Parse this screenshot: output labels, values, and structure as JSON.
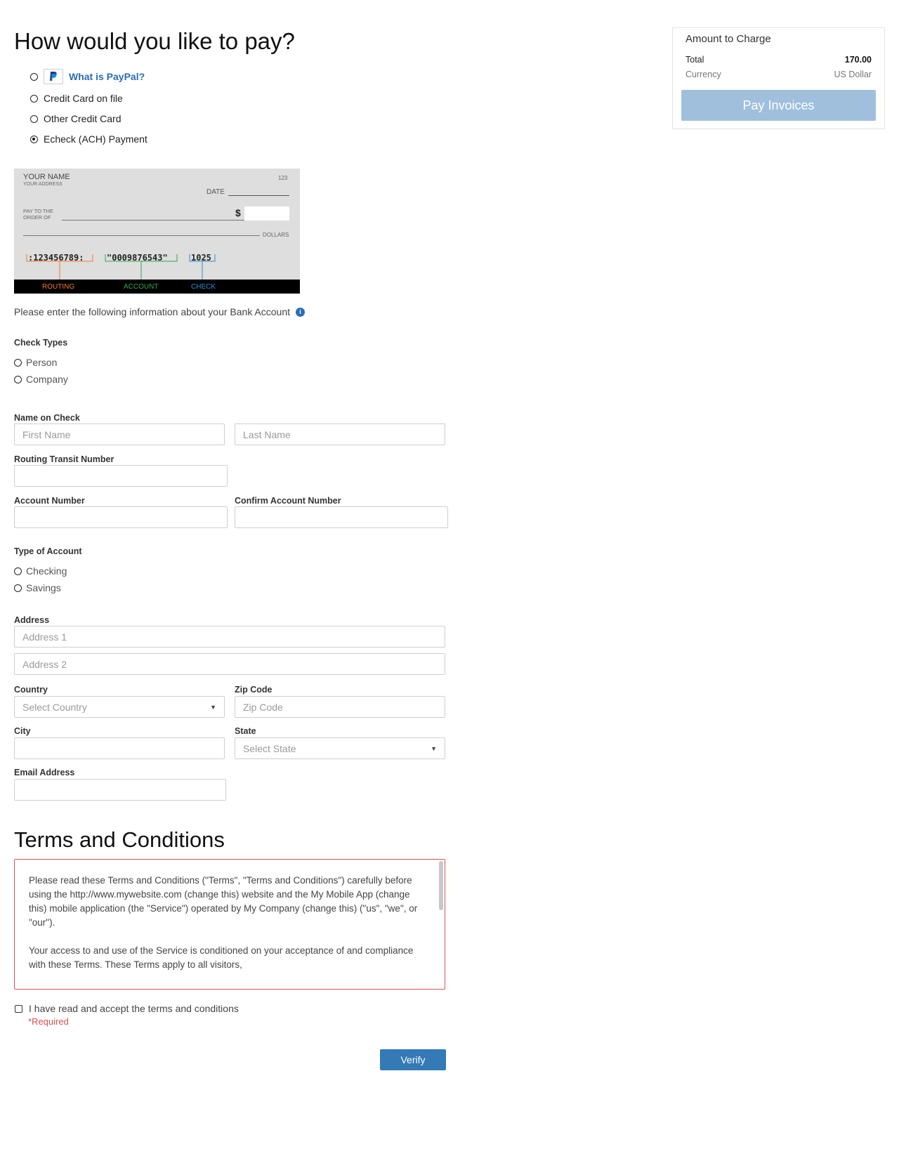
{
  "payment": {
    "title": "How would you like to pay?",
    "options": [
      {
        "label": "What is PayPal?",
        "selected": false,
        "icon": "paypal-logo-icon",
        "is_link": true
      },
      {
        "label": "Credit Card on file",
        "selected": false
      },
      {
        "label": "Other Credit Card",
        "selected": false
      },
      {
        "label": "Echeck (ACH) Payment",
        "selected": true
      }
    ]
  },
  "check_image": {
    "your_name": "YOUR NAME",
    "your_address": "YOUR ADDRESS",
    "check_no": "123",
    "date_label": "DATE",
    "pay_to_line1": "PAY TO THE",
    "pay_to_line2": "ORDER OF",
    "dollar_sign": "$",
    "dollars_label": "DOLLARS",
    "routing_number": ":123456789:",
    "account_number": "\"0009876543\"",
    "check_number": "1025",
    "routing_label": "ROUTING",
    "account_label": "ACCOUNT",
    "check_label": "CHECK",
    "colors": {
      "routing": "#f07a2a",
      "account": "#2fa84f",
      "check": "#2a8fd6",
      "band": "#000000"
    }
  },
  "bank_info": {
    "intro": "Please enter the following information about your Bank Account",
    "info_icon": "info-icon"
  },
  "check_types": {
    "label": "Check Types",
    "options": [
      "Person",
      "Company"
    ]
  },
  "name_on_check": {
    "label": "Name on Check",
    "first_placeholder": "First Name",
    "last_placeholder": "Last Name"
  },
  "routing": {
    "label": "Routing Transit Number",
    "value": ""
  },
  "account": {
    "label": "Account Number",
    "confirm_label": "Confirm Account Number"
  },
  "account_type": {
    "label": "Type of Account",
    "options": [
      "Checking",
      "Savings"
    ]
  },
  "address": {
    "label": "Address",
    "address1_placeholder": "Address 1",
    "address2_placeholder": "Address 2",
    "country_label": "Country",
    "country_placeholder": "Select Country",
    "zip_label": "Zip Code",
    "zip_placeholder": "Zip Code",
    "city_label": "City",
    "state_label": "State",
    "state_placeholder": "Select State",
    "email_label": "Email Address"
  },
  "terms": {
    "title": "Terms and Conditions",
    "paragraph1": "Please read these Terms and Conditions (\"Terms\", \"Terms and Conditions\") carefully before using the http://www.mywebsite.com (change this) website and the My Mobile App (change this) mobile application (the \"Service\") operated by My Company (change this) (\"us\", \"we\", or \"our\").",
    "paragraph2": "Your access to and use of the Service is conditioned on your acceptance of and compliance with these Terms. These Terms apply to all visitors,",
    "accept_label": "I have read and accept the terms and conditions",
    "required_text": "*Required",
    "accent_color": "#d9534f"
  },
  "verify_button": {
    "label": "Verify",
    "color": "#337ab7"
  },
  "summary": {
    "title": "Amount to Charge",
    "total_label": "Total",
    "total_value": "170.00",
    "currency_label": "Currency",
    "currency_value": "US Dollar",
    "pay_button": "Pay Invoices",
    "pay_button_color": "#9fbfdd"
  }
}
